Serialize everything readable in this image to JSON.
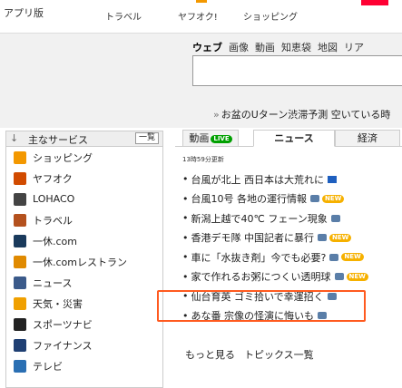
{
  "topnav": {
    "app": "アプリ版",
    "travel": "トラベル",
    "auction": "ヤフオク!",
    "shopping": "ショッピング"
  },
  "search": {
    "tabs": [
      "ウェブ",
      "画像",
      "動画",
      "知恵袋",
      "地図",
      "リア"
    ],
    "hotline": "お盆のUターン渋滞予測 空いている時"
  },
  "sidebar": {
    "title": "主なサービス",
    "list_button": "一覧",
    "items": [
      {
        "label": "ショッピング",
        "color": "#f39800"
      },
      {
        "label": "ヤフオク",
        "color": "#d14b00"
      },
      {
        "label": "LOHACO",
        "color": "#444444"
      },
      {
        "label": "トラベル",
        "color": "#b4511e"
      },
      {
        "label": "一休.com",
        "color": "#1a3a5c"
      },
      {
        "label": "一休.comレストラン",
        "color": "#e08a00"
      },
      {
        "label": "ニュース",
        "color": "#3b5a8a"
      },
      {
        "label": "天気・災害",
        "color": "#f0a000"
      },
      {
        "label": "スポーツナビ",
        "color": "#222222"
      },
      {
        "label": "ファイナンス",
        "color": "#1f3f73"
      },
      {
        "label": "テレビ",
        "color": "#2a6fb3"
      }
    ]
  },
  "news": {
    "tabs": {
      "video": "動画",
      "live": "LIVE",
      "news": "ニュース",
      "economy": "経済"
    },
    "updated": "13時59分更新",
    "items": [
      {
        "text": "台風が北上 西日本は大荒れに",
        "icon": "video-icon",
        "new": false
      },
      {
        "text": "台風10号 各地の運行情報",
        "icon": "camera-icon",
        "new": true
      },
      {
        "text": "新潟上越で40℃ フェーン現象",
        "icon": "camera-icon",
        "new": false
      },
      {
        "text": "香港デモ隊 中国記者に暴行",
        "icon": "camera-icon",
        "new": true
      },
      {
        "text": "車に「水抜き剤」今でも必要?",
        "icon": "camera-icon",
        "new": true
      },
      {
        "text": "家で作れるお粥につくい透明球",
        "icon": "camera-icon",
        "new": true
      },
      {
        "text": "仙台育英 ゴミ拾いで幸運招く",
        "icon": "camera-icon",
        "new": false
      },
      {
        "text": "あな番 宗像の怪演に悔いも",
        "icon": "camera-icon",
        "new": false
      }
    ],
    "new_label": "NEW",
    "more": "もっと見る",
    "topics": "トピックス一覧"
  }
}
